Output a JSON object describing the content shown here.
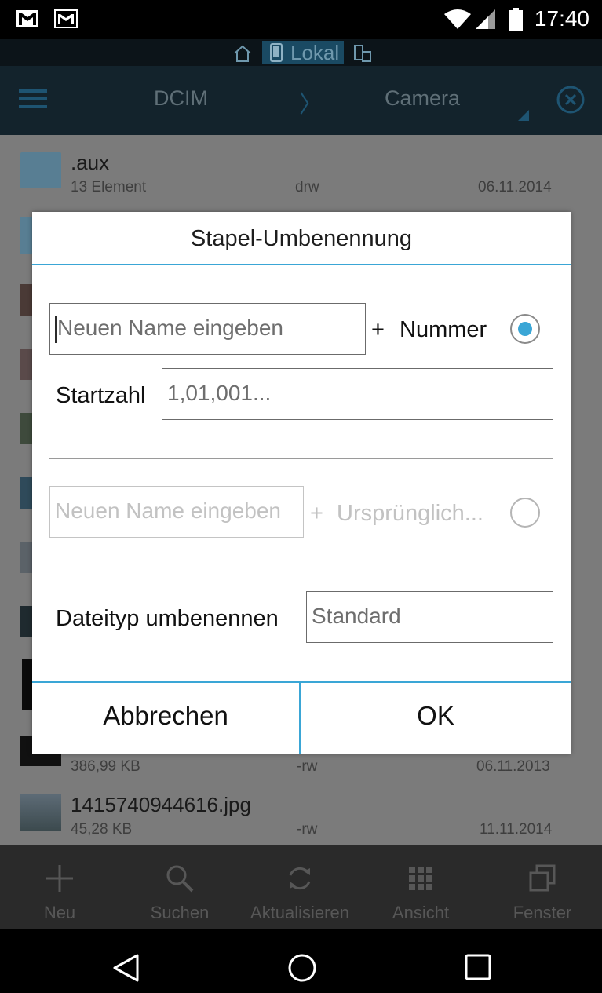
{
  "status": {
    "time": "17:40"
  },
  "location": {
    "label": "Lokal"
  },
  "toolbar": {
    "crumb1": "DCIM",
    "crumb2": "Camera"
  },
  "files": [
    {
      "name": ".aux",
      "size": "13 Element",
      "perm": "drw",
      "date": "06.11.2014"
    },
    {
      "name": "",
      "size": "386,99 KB",
      "perm": "-rw",
      "date": "06.11.2013"
    },
    {
      "name": "1415740944616.jpg",
      "size": "45,28 KB",
      "perm": "-rw",
      "date": "11.11.2014"
    }
  ],
  "actions": [
    {
      "label": "Neu",
      "icon": "plus-icon"
    },
    {
      "label": "Suchen",
      "icon": "search-icon"
    },
    {
      "label": "Aktualisieren",
      "icon": "refresh-icon"
    },
    {
      "label": "Ansicht",
      "icon": "grid-icon"
    },
    {
      "label": "Fenster",
      "icon": "windows-icon"
    }
  ],
  "dialog": {
    "title": "Stapel-Umbenennung",
    "name_placeholder": "Neuen Name eingeben",
    "plus": "+",
    "number_label": "Nummer",
    "start_label": "Startzahl",
    "start_placeholder": "1,01,001...",
    "name2_placeholder": "Neuen Name eingeben",
    "original_label": "Ursprünglich...",
    "filetype_label": "Dateityp umbenennen",
    "filetype_placeholder": "Standard",
    "cancel": "Abbrechen",
    "ok": "OK",
    "selected_option": "Nummer"
  },
  "colors": {
    "accent": "#3aa6d6",
    "toolbar": "#13232c"
  }
}
